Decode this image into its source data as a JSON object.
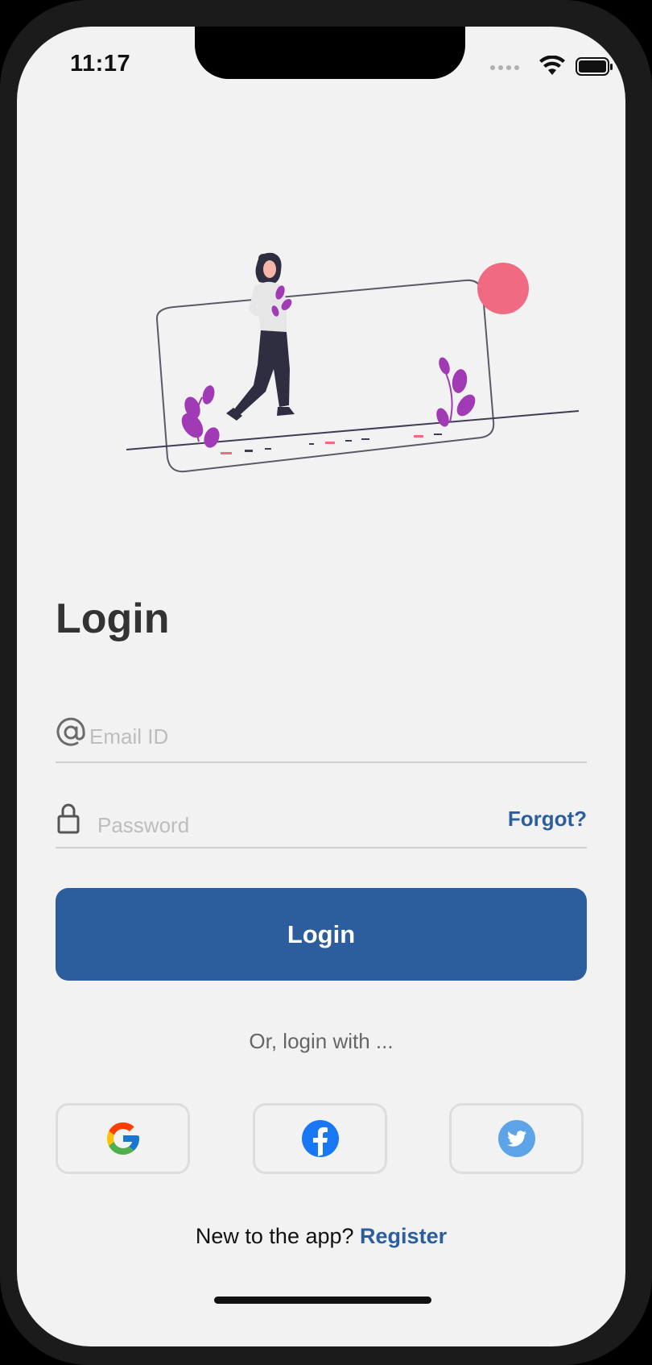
{
  "status_bar": {
    "time": "11:17"
  },
  "login": {
    "title": "Login",
    "email_placeholder": "Email ID",
    "password_placeholder": "Password",
    "forgot_label": "Forgot?",
    "button_label": "Login",
    "divider_text": "Or, login with ...",
    "social": [
      {
        "icon": "google-icon"
      },
      {
        "icon": "facebook-icon"
      },
      {
        "icon": "twitter-icon"
      }
    ],
    "register_prompt": "New to the app?",
    "register_link": "Register"
  },
  "colors": {
    "primary": "#2c5e9e",
    "background": "#f2f2f2",
    "accent_pink": "#f06a82",
    "plant_purple": "#a03ab5"
  }
}
